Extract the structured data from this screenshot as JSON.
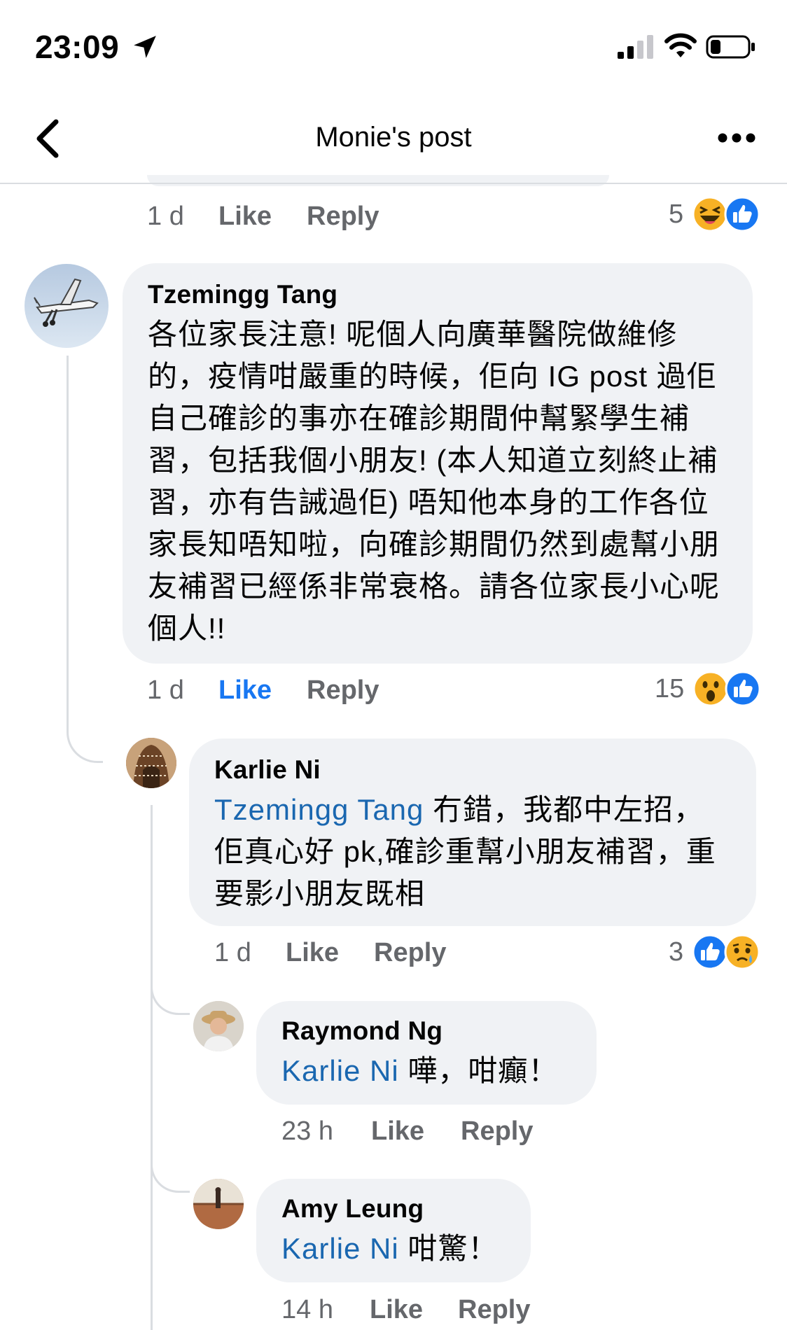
{
  "status_bar": {
    "time": "23:09"
  },
  "header": {
    "title": "Monie's post"
  },
  "prev_comment": {
    "time": "1 d",
    "like": "Like",
    "reply": "Reply",
    "reaction_count": "5"
  },
  "comments": [
    {
      "author": "Tzemingg Tang",
      "text": "各位家長注意! 呢個人向廣華醫院做維修的，疫情咁嚴重的時候，佢向 IG post 過佢自己確診的事亦在確診期間仲幫緊學生補習，包括我個小朋友! (本人知道立刻終止補習，亦有告誡過佢) 唔知他本身的工作各位家長知唔知啦，向確診期間仍然到處幫小朋友補習已經係非常衰格。請各位家長小心呢個人!!",
      "time": "1 d",
      "like": "Like",
      "reply": "Reply",
      "reaction_count": "15"
    },
    {
      "author": "Karlie Ni",
      "mention": "Tzemingg Tang",
      "text": " 冇錯，我都中左招，佢真心好 pk,確診重幫小朋友補習，重要影小朋友既相",
      "time": "1 d",
      "like": "Like",
      "reply": "Reply",
      "reaction_count": "3"
    },
    {
      "author": "Raymond Ng",
      "mention": "Karlie Ni",
      "text": " 嘩，咁癲！",
      "time": "23 h",
      "like": "Like",
      "reply": "Reply"
    },
    {
      "author": "Amy Leung",
      "mention": "Karlie Ni",
      "text": " 咁驚！",
      "time": "14 h",
      "like": "Like",
      "reply": "Reply"
    }
  ],
  "colors": {
    "like_active": "#1877f2",
    "mention": "#1a67b0",
    "bubble": "#f0f2f5",
    "meta": "#65676b"
  }
}
